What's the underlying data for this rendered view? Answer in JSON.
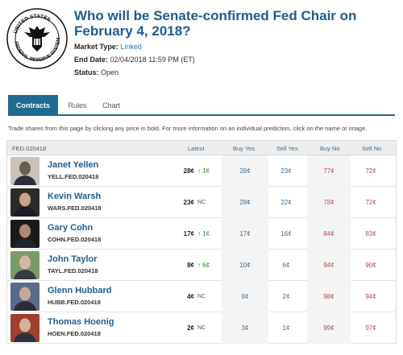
{
  "header": {
    "title": "Who will be Senate-confirmed Fed Chair on February 4, 2018?",
    "market_type_label": "Market Type:",
    "market_type_value": "Linked",
    "end_date_label": "End Date:",
    "end_date_value": "02/04/2018 11:59 PM (ET)",
    "status_label": "Status:",
    "status_value": "Open",
    "seal_text": "UNITED STATES FEDERAL RESERVE SYSTEM"
  },
  "tabs": [
    "Contracts",
    "Rules",
    "Chart"
  ],
  "instructions": "Trade shares from this page by clicking any price in bold. For more information on an individual prediction, click on the name or image.",
  "table": {
    "code": "FED.020418",
    "columns": [
      "Latest",
      "Buy Yes",
      "Sell Yes",
      "Buy No",
      "Sell No"
    ],
    "rows": [
      {
        "name": "Janet Yellen",
        "ticker": "YELL.FED.020418",
        "latest": "28¢",
        "change": "1¢",
        "buy_yes": "28¢",
        "sell_yes": "23¢",
        "buy_no": "77¢",
        "sell_no": "72¢"
      },
      {
        "name": "Kevin Warsh",
        "ticker": "WARS.FED.020418",
        "latest": "23¢",
        "change": "NC",
        "buy_yes": "28¢",
        "sell_yes": "22¢",
        "buy_no": "78¢",
        "sell_no": "72¢"
      },
      {
        "name": "Gary Cohn",
        "ticker": "COHN.FED.020418",
        "latest": "17¢",
        "change": "1¢",
        "buy_yes": "17¢",
        "sell_yes": "16¢",
        "buy_no": "84¢",
        "sell_no": "83¢"
      },
      {
        "name": "John Taylor",
        "ticker": "TAYL.FED.020418",
        "latest": "8¢",
        "change": "6¢",
        "buy_yes": "10¢",
        "sell_yes": "6¢",
        "buy_no": "94¢",
        "sell_no": "90¢"
      },
      {
        "name": "Glenn Hubbard",
        "ticker": "HUBB.FED.020418",
        "latest": "4¢",
        "change": "NC",
        "buy_yes": "6¢",
        "sell_yes": "2¢",
        "buy_no": "98¢",
        "sell_no": "94¢"
      },
      {
        "name": "Thomas Hoenig",
        "ticker": "HOEN.FED.020418",
        "latest": "2¢",
        "change": "NC",
        "buy_yes": "3¢",
        "sell_yes": "1¢",
        "buy_no": "99¢",
        "sell_no": "97¢"
      }
    ]
  },
  "colors": {
    "accent": "#1f6a8f",
    "title": "#1f5d8f",
    "up": "#2e8b2e",
    "no_price": "#b14b4b"
  }
}
